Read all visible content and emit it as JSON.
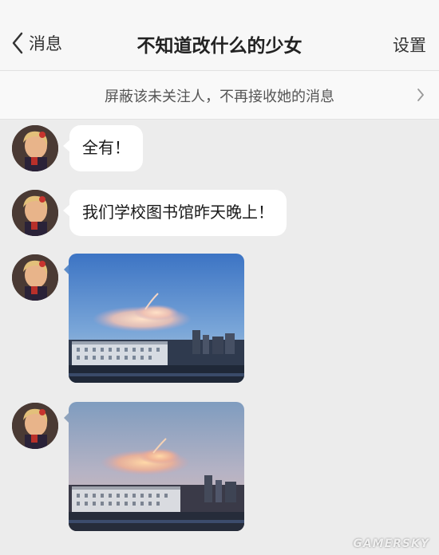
{
  "nav": {
    "back_label": "消息",
    "title": "不知道改什么的少女",
    "settings_label": "设置"
  },
  "block_bar": {
    "text": "屏蔽该未关注人，不再接收她的消息"
  },
  "messages": [
    {
      "type": "text",
      "text": "全有！"
    },
    {
      "type": "text",
      "text": "我们学校图书馆昨天晚上！"
    },
    {
      "type": "image",
      "subject": "sky-cloud-campus-photo"
    },
    {
      "type": "image",
      "subject": "sky-cloud-campus-photo"
    }
  ],
  "watermark": "GAMERSKY",
  "colors": {
    "page_bg": "#ececec",
    "bubble_bg": "#ffffff",
    "nav_bg": "#f7f7f7"
  }
}
